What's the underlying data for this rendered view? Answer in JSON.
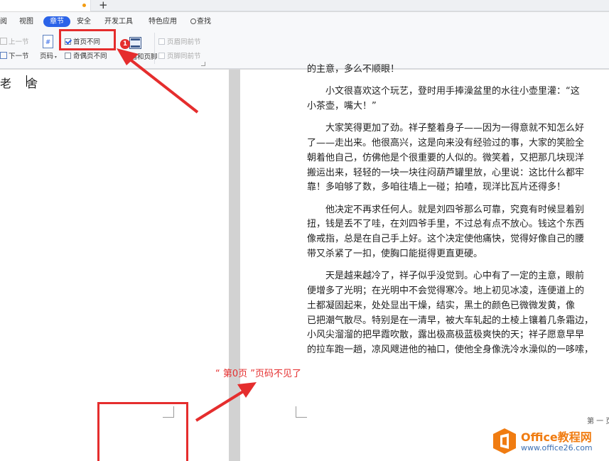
{
  "tabbar": {
    "new_tab_label": "+"
  },
  "ribbon": {
    "menus": [
      {
        "label": "阅",
        "name": "menu-review"
      },
      {
        "label": "视图",
        "name": "menu-view"
      },
      {
        "label": "章节",
        "name": "menu-section"
      },
      {
        "label": "安全",
        "name": "menu-security"
      },
      {
        "label": "开发工具",
        "name": "menu-devtools"
      },
      {
        "label": "特色应用",
        "name": "menu-features"
      },
      {
        "label": "查找",
        "name": "menu-search"
      }
    ],
    "prev_section": "上一节",
    "next_section": "下一节",
    "page_number": "页码",
    "page_number_icon": "#",
    "first_page_different": "首页不同",
    "first_page_checked": true,
    "odd_even_different": "奇偶页不同",
    "odd_even_checked": false,
    "header_footer": "页眉和页脚",
    "header_same_as_prev": "页眉同前节",
    "footer_same_as_prev": "页脚同前节"
  },
  "document": {
    "author": "老 舍",
    "paragraphs": [
      [
        "的主意，多么不顺眼！"
      ],
      [
        "　　小文很喜欢这个玩艺，登时用手捧澡盆里的水往小壶里灌：“这",
        "小茶壶，嘴大！”"
      ],
      [
        "　　大家笑得更加了劲。祥子整着身子——因为一得意就不知怎么好",
        "了——走出来。他很高兴，这是向来没有经验过的事，大家的笑脸全",
        "朝着他自己，仿佛他是个很重要的人似的。微笑着，又把那几块现洋",
        "搬运出来，轻轻的一块一块往闷葫芦罐里放，心里说：这比什么都牢",
        "靠！多咱够了数，多咱往墙上一碰；拍喳，现洋比瓦片还得多！"
      ],
      [
        "　　他决定不再求任何人。就是刘四爷那么可靠，究竟有时候显着别",
        "扭，钱是丢不了哇，在刘四爷手里，不过总有点不放心。钱这个东西",
        "像戒指，总是在自己手上好。这个决定使他痛快，觉得好像自己的腰",
        "带又杀紧了一扣，使胸口能挺得更直更硬。"
      ],
      [
        "　　天是越来越冷了，祥子似乎没觉到。心中有了一定的主意，眼前",
        "便增多了光明；在光明中不会觉得寒冷。地上初见冰凌，连便道上的",
        "土都凝固起来，处处显出干燥，结实，黑土的颜色已微微发黄，像",
        "已把潮气散尽。特别是在一清早，被大车轧起的土棱上镶着几条霜边，",
        "小风尖溜溜的把早霞吹散，露出极高极蓝极爽快的天；祥子愿意早早",
        "的拉车跑一趟，凉风飕进他的袖口，使他全身像洗冷水澡似的一哆嗦，"
      ]
    ],
    "footer_page_label": "第 一 页"
  },
  "annotations": {
    "badge_number": "1",
    "caption": "“ 第0页 ”页码不见了",
    "accent_color": "#e52d2d"
  },
  "logo": {
    "title": "Office教程网",
    "url": "www.office26.com",
    "brand_color": "#f07c11"
  }
}
